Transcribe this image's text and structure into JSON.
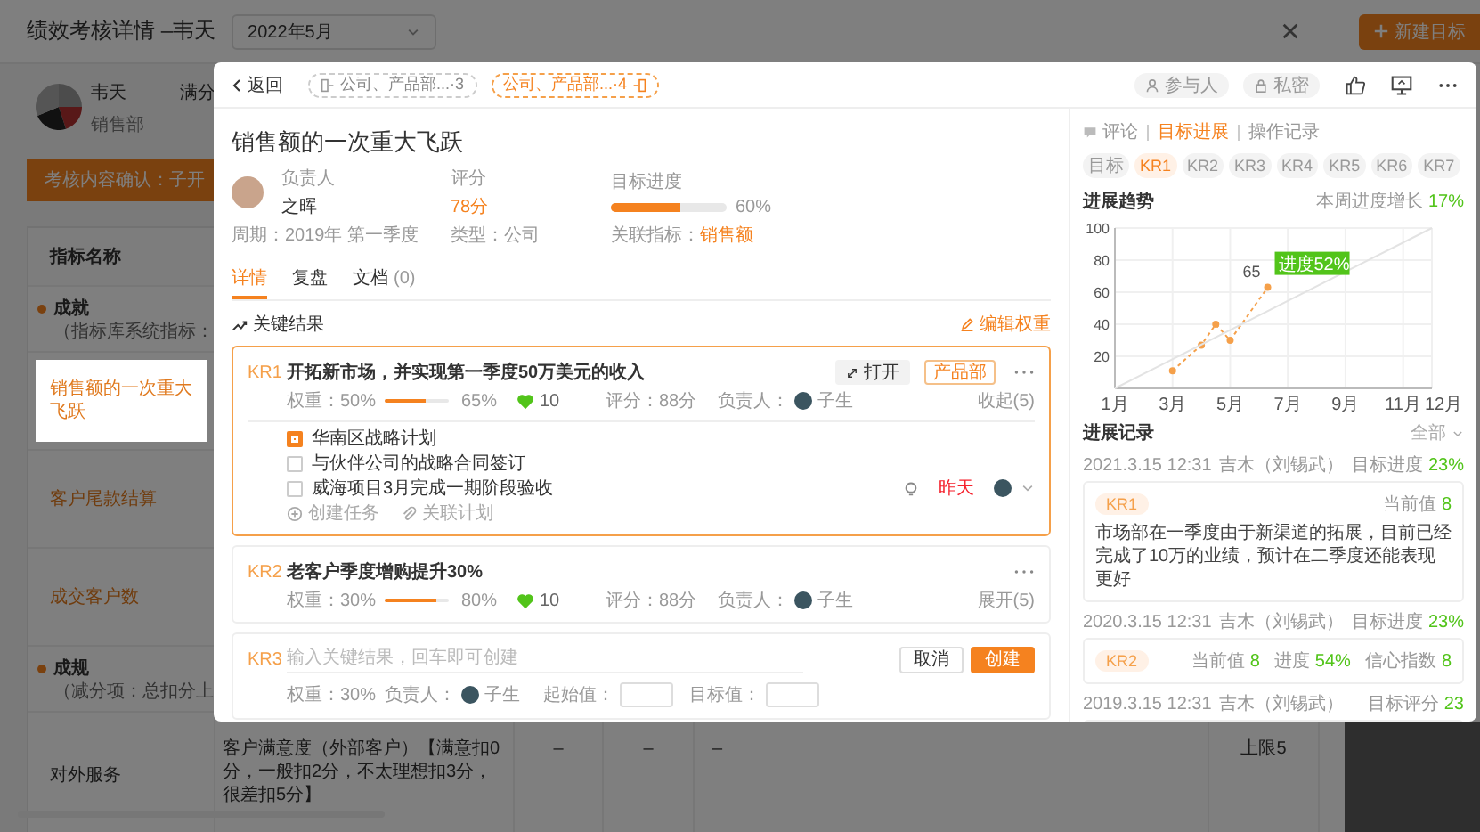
{
  "page": {
    "title": "绩效考核详情 –韦天",
    "month": "2022年5月",
    "new_button": "新建目标"
  },
  "profile": {
    "name": "韦天",
    "department": "销售部",
    "score_label": "满分"
  },
  "banner": "考核内容确认：子开",
  "table": {
    "header": "指标名称",
    "sections": [
      {
        "title": "成就",
        "note": "（指标库系统指标：",
        "rows": [
          {
            "name": "销售额的一次重大飞跃",
            "kind": "link",
            "selected": true
          },
          {
            "name": "客户尾款结算",
            "kind": "link",
            "selected": false
          },
          {
            "name": "成交客户数",
            "kind": "link",
            "selected": false
          }
        ]
      },
      {
        "title": "成规",
        "note": "（减分项：总扣分上",
        "rows": [
          {
            "name": "对外服务",
            "kind": "plain",
            "selected": false,
            "cells": [
              "客户满意度（外部客户）【满意扣0分，一般扣2分，不太理想扣3分，很差扣5分】",
              "–",
              "–",
              "–",
              "上限5"
            ]
          }
        ]
      }
    ]
  },
  "modal": {
    "back": "返回",
    "breadcrumbs": [
      {
        "label": "公司、产品部...·3",
        "selected": false
      },
      {
        "label": "公司、产品部...·4",
        "selected": true
      }
    ],
    "participants": "参与人",
    "privacy": "私密",
    "objective": {
      "title": "销售额的一次重大飞跃",
      "owner_label": "负责人",
      "owner": "之晖",
      "score_label": "评分",
      "score": "78分",
      "progress_label": "目标进度",
      "progress": {
        "level": 0.6,
        "reading": "60%"
      },
      "period": "周期：2019年 第一季度",
      "type": "类型：公司",
      "related_label": "关联指标：",
      "related": "销售额"
    },
    "tabs": [
      {
        "label": "详情",
        "selected": true
      },
      {
        "label": "复盘",
        "selected": false
      },
      {
        "label": "文档",
        "count": "(0)",
        "selected": false
      }
    ],
    "key_results": {
      "title": "关键结果",
      "edit": "编辑权重",
      "items": [
        {
          "kind": "result",
          "code": "KR1",
          "title": "开拓新市场，并实现第一季度50万美元的收入",
          "selected": true,
          "expanded": true,
          "open": "打开",
          "tag": "产品部",
          "weight": "权重：50%",
          "progress": {
            "level": 0.65,
            "reading": "65%"
          },
          "likes": "10",
          "score": "评分：88分",
          "owner_label": "负责人：",
          "owner": "子生",
          "toggle": "收起(5)",
          "tasks": [
            {
              "title": "华南区战略计划",
              "checked": true
            },
            {
              "title": "与伙伴公司的战略合同签订",
              "checked": false
            },
            {
              "title": "威海项目3月完成一期阶段验收",
              "checked": false,
              "due": "昨天"
            }
          ],
          "actions": [
            "创建任务",
            "关联计划"
          ]
        },
        {
          "kind": "result",
          "code": "KR2",
          "title": "老客户季度增购提升30%",
          "selected": false,
          "expanded": false,
          "weight": "权重：30%",
          "progress": {
            "level": 0.8,
            "reading": "80%"
          },
          "likes": "10",
          "score": "评分：88分",
          "owner_label": "负责人：",
          "owner": "子生",
          "toggle": "展开(5)"
        },
        {
          "kind": "draft",
          "code": "KR3",
          "placeholder": "输入关键结果，回车即可创建",
          "cancel": "取消",
          "create": "创建",
          "weight": "权重：30%",
          "owner_label": "负责人：",
          "owner": "子生",
          "start_label": "起始值：",
          "target_label": "目标值："
        }
      ]
    },
    "progress_panel": {
      "tabs": [
        {
          "label": "评论",
          "selected": false
        },
        {
          "label": "目标进展",
          "selected": true
        },
        {
          "label": "操作记录",
          "selected": false
        }
      ],
      "chips": [
        {
          "label": "目标",
          "selected": false
        },
        {
          "label": "KR1",
          "selected": true
        },
        {
          "label": "KR2",
          "selected": false
        },
        {
          "label": "KR3",
          "selected": false
        },
        {
          "label": "KR4",
          "selected": false
        },
        {
          "label": "KR5",
          "selected": false
        },
        {
          "label": "KR6",
          "selected": false
        },
        {
          "label": "KR7",
          "selected": false
        }
      ],
      "trend": {
        "title": "进展趋势",
        "growth_label": "本周进度增长",
        "growth": "17%",
        "chart_data": {
          "type": "line",
          "xlim": [
            1,
            12
          ],
          "ylim": [
            0,
            100
          ],
          "xticks": [
            {
              "value": 1,
              "label": "1月"
            },
            {
              "value": 3,
              "label": "3月"
            },
            {
              "value": 5,
              "label": "5月"
            },
            {
              "value": 7,
              "label": "7月"
            },
            {
              "value": 9,
              "label": "9月"
            },
            {
              "value": 11,
              "label": "11月"
            },
            {
              "value": 12,
              "label": "12月"
            }
          ],
          "yticks": [
            20,
            40,
            60,
            80,
            100
          ],
          "x": [
            1,
            3,
            4,
            4.5,
            5,
            6.3,
            12
          ],
          "grid": true,
          "series": [
            {
              "color": "#f5a04a",
              "line_style": "dashed",
              "marker": "circle",
              "values": [
                null,
                11,
                27,
                40,
                30,
                63,
                null
              ]
            },
            {
              "color": "#e3e3e3",
              "line_style": "solid",
              "marker": "none",
              "values": [
                0,
                null,
                null,
                null,
                null,
                null,
                100
              ]
            }
          ],
          "annotations": [
            {
              "x": 6.3,
              "y": 63,
              "text": "65"
            },
            {
              "x": 6.3,
              "y": 63,
              "text": "进度52%"
            }
          ]
        }
      },
      "records": {
        "title": "进展记录",
        "filter": "全部",
        "items": [
          {
            "time": "2021.3.15 12:31",
            "author": "吉木（刘锡武）",
            "metric_label": "目标进度",
            "metric": "23%",
            "tag": "KR1",
            "stats": [
              {
                "label": "当前值",
                "value": "8"
              }
            ],
            "note": "市场部在一季度由于新渠道的拓展，目前已经完成了10万的业绩，预计在二季度还能表现更好"
          },
          {
            "time": "2020.3.15 12:31",
            "author": "吉木（刘锡武）",
            "metric_label": "目标进度",
            "metric": "23%",
            "tag": "KR2",
            "stats": [
              {
                "label": "当前值",
                "value": "8"
              },
              {
                "label": "进度",
                "value": "54%"
              },
              {
                "label": "信心指数",
                "value": "8"
              }
            ]
          },
          {
            "time": "2019.3.15 12:31",
            "author": "吉木（刘锡武）",
            "metric_label": "目标评分",
            "metric": "23"
          }
        ]
      }
    }
  }
}
